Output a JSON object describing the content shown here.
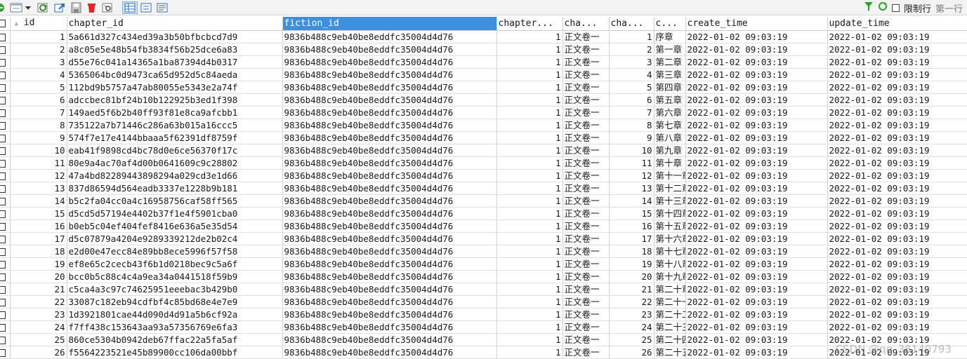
{
  "toolbar": {
    "buttons": [
      "add-row",
      "view-menu",
      "refresh",
      "export",
      "save",
      "delete",
      "filter-view",
      "grid-view",
      "form-view",
      "text-view"
    ],
    "limit_label": "限制行",
    "first_row_label": "第一行"
  },
  "table": {
    "headers": [
      "id",
      "chapter_id",
      "fiction_id",
      "chapter...",
      "cha...",
      "cha...",
      "c...",
      "create_time",
      "update_time"
    ],
    "rows": [
      [
        "1",
        "5a661d327c434ed39a3b50bfbcbcd7d9",
        "9836b488c9eb40be8eddfc35004d4d76",
        "1",
        "正文卷一",
        "1",
        "序章",
        "2022-01-02 09:03:19",
        "2022-01-02 09:03:19"
      ],
      [
        "2",
        "a8c05e5e48b54fb3834f56b25dce6a83",
        "9836b488c9eb40be8eddfc35004d4d76",
        "1",
        "正文卷一",
        "2",
        "第一章",
        "2022-01-02 09:03:19",
        "2022-01-02 09:03:19"
      ],
      [
        "3",
        "d55e76c041a14365a1ba87394d4b0317",
        "9836b488c9eb40be8eddfc35004d4d76",
        "1",
        "正文卷一",
        "3",
        "第二章",
        "2022-01-02 09:03:19",
        "2022-01-02 09:03:19"
      ],
      [
        "4",
        "5365064bc0d9473ca65d952d5c84aeda",
        "9836b488c9eb40be8eddfc35004d4d76",
        "1",
        "正文卷一",
        "4",
        "第三章",
        "2022-01-02 09:03:19",
        "2022-01-02 09:03:19"
      ],
      [
        "5",
        "112bd9b5757a47ab80055e5343e2a74f",
        "9836b488c9eb40be8eddfc35004d4d76",
        "1",
        "正文卷一",
        "5",
        "第四章",
        "2022-01-02 09:03:19",
        "2022-01-02 09:03:19"
      ],
      [
        "6",
        "adccbec81bf24b10b122925b3ed1f398",
        "9836b488c9eb40be8eddfc35004d4d76",
        "1",
        "正文卷一",
        "6",
        "第五章",
        "2022-01-02 09:03:19",
        "2022-01-02 09:03:19"
      ],
      [
        "7",
        "149aed5f6b2b40ff93f81e8ca9afcbb1",
        "9836b488c9eb40be8eddfc35004d4d76",
        "1",
        "正文卷一",
        "7",
        "第六章",
        "2022-01-02 09:03:19",
        "2022-01-02 09:03:19"
      ],
      [
        "8",
        "735122a7b71446c286a63b015a16ccc5",
        "9836b488c9eb40be8eddfc35004d4d76",
        "1",
        "正文卷一",
        "8",
        "第七章",
        "2022-01-02 09:03:19",
        "2022-01-02 09:03:19"
      ],
      [
        "9",
        "574f7e17e4144bbaaa5f62391df8759f",
        "9836b488c9eb40be8eddfc35004d4d76",
        "1",
        "正文卷一",
        "9",
        "第八章",
        "2022-01-02 09:03:19",
        "2022-01-02 09:03:19"
      ],
      [
        "10",
        "eab41f9898cd4bc78d0e6ce56370f17c",
        "9836b488c9eb40be8eddfc35004d4d76",
        "1",
        "正文卷一",
        "10",
        "第九章",
        "2022-01-02 09:03:19",
        "2022-01-02 09:03:19"
      ],
      [
        "11",
        "80e9a4ac70af4d00b0641609c9c28802",
        "9836b488c9eb40be8eddfc35004d4d76",
        "1",
        "正文卷一",
        "11",
        "第十章",
        "2022-01-02 09:03:19",
        "2022-01-02 09:03:19"
      ],
      [
        "12",
        "47a4bd82289443898294a029cd3e1d66",
        "9836b488c9eb40be8eddfc35004d4d76",
        "1",
        "正文卷一",
        "12",
        "第十一章",
        "2022-01-02 09:03:19",
        "2022-01-02 09:03:19"
      ],
      [
        "13",
        "837d86594d564eadb3337e1228b9b181",
        "9836b488c9eb40be8eddfc35004d4d76",
        "1",
        "正文卷一",
        "13",
        "第十二章",
        "2022-01-02 09:03:19",
        "2022-01-02 09:03:19"
      ],
      [
        "14",
        "b5c2fa04cc0a4c16958756caf58ff565",
        "9836b488c9eb40be8eddfc35004d4d76",
        "1",
        "正文卷一",
        "14",
        "第十三章",
        "2022-01-02 09:03:19",
        "2022-01-02 09:03:19"
      ],
      [
        "15",
        "d5cd5d57194e4402b37f1e4f5901cba0",
        "9836b488c9eb40be8eddfc35004d4d76",
        "1",
        "正文卷一",
        "15",
        "第十四章",
        "2022-01-02 09:03:19",
        "2022-01-02 09:03:19"
      ],
      [
        "16",
        "b0eb5c04ef404fef8416e636a5e35d54",
        "9836b488c9eb40be8eddfc35004d4d76",
        "1",
        "正文卷一",
        "16",
        "第十五章",
        "2022-01-02 09:03:19",
        "2022-01-02 09:03:19"
      ],
      [
        "17",
        "d5c07879a4204e9289339212de2b02c4",
        "9836b488c9eb40be8eddfc35004d4d76",
        "1",
        "正文卷一",
        "17",
        "第十六章",
        "2022-01-02 09:03:19",
        "2022-01-02 09:03:19"
      ],
      [
        "18",
        "e2d00e47ecc84e89bb8ece5996f57f58",
        "9836b488c9eb40be8eddfc35004d4d76",
        "1",
        "正文卷一",
        "18",
        "第十七章",
        "2022-01-02 09:03:19",
        "2022-01-02 09:03:19"
      ],
      [
        "19",
        "ef8e65c2cecb43f6b1d0218bec9c5a6f",
        "9836b488c9eb40be8eddfc35004d4d76",
        "1",
        "正文卷一",
        "19",
        "第十八章",
        "2022-01-02 09:03:19",
        "2022-01-02 09:03:19"
      ],
      [
        "20",
        "bcc0b5c88c4c4a9ea34a0441518f59b9",
        "9836b488c9eb40be8eddfc35004d4d76",
        "1",
        "正文卷一",
        "20",
        "第十九章",
        "2022-01-02 09:03:19",
        "2022-01-02 09:03:19"
      ],
      [
        "21",
        "c5ca4a3c97c74625951eeebac3b429b0",
        "9836b488c9eb40be8eddfc35004d4d76",
        "1",
        "正文卷一",
        "21",
        "第二十章",
        "2022-01-02 09:03:19",
        "2022-01-02 09:03:19"
      ],
      [
        "22",
        "33087c182eb94cdfbf4c85bd68e4e7e9",
        "9836b488c9eb40be8eddfc35004d4d76",
        "1",
        "正文卷一",
        "22",
        "第二十一章",
        "2022-01-02 09:03:19",
        "2022-01-02 09:03:19"
      ],
      [
        "23",
        "1d3921801cae44d090d4d91a5b6cf92a",
        "9836b488c9eb40be8eddfc35004d4d76",
        "1",
        "正文卷一",
        "23",
        "第二十二章",
        "2022-01-02 09:03:19",
        "2022-01-02 09:03:19"
      ],
      [
        "24",
        "f7ff438c153643aa93a57356769e6fa3",
        "9836b488c9eb40be8eddfc35004d4d76",
        "1",
        "正文卷一",
        "24",
        "第二十三章",
        "2022-01-02 09:03:19",
        "2022-01-02 09:03:19"
      ],
      [
        "25",
        "860ce5304b0942deb67ffac22a5fa5af",
        "9836b488c9eb40be8eddfc35004d4d76",
        "1",
        "正文卷一",
        "25",
        "第二十四章",
        "2022-01-02 09:03:19",
        "2022-01-02 09:03:19"
      ],
      [
        "26",
        "f5564223521e45b89900cc106da00bbf",
        "9836b488c9eb40be8eddfc35004d4d76",
        "1",
        "正文卷一",
        "26",
        "第二十五章",
        "2022-01-02 09:03:19",
        "2022-01-02 09:03:19"
      ]
    ]
  },
  "watermark": "CSDN @qq_38140793",
  "colors": {
    "selected_header": "#3d8fe0",
    "filter_green": "#2aa52a",
    "delete_red": "#e02828"
  }
}
